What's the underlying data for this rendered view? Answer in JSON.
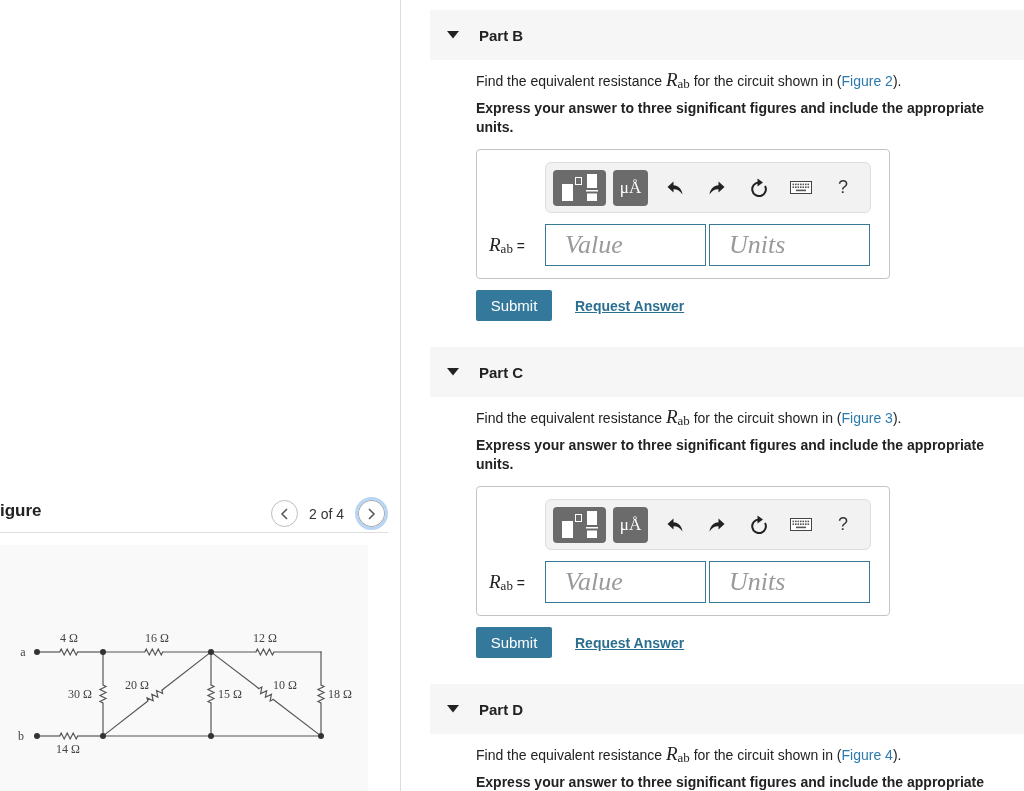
{
  "figure_panel": {
    "title": "igure",
    "nav": {
      "previous": {
        "focused": false
      },
      "counter": "2 of 4",
      "next": {
        "focused": true
      }
    },
    "circuit": {
      "terminals": [
        "a",
        "b"
      ],
      "resistors": [
        "4 Ω",
        "16 Ω",
        "12 Ω",
        "30 Ω",
        "20 Ω",
        "15 Ω",
        "10 Ω",
        "18 Ω",
        "14 Ω"
      ]
    }
  },
  "parts": [
    {
      "title": "Part B",
      "expanded": true,
      "prompt_before": "Find the equivalent resistance *R*$_{ab}$ for the circuit shown in (",
      "figure_link": "Figure 2",
      "prompt_after": ").",
      "instruction": "Express your answer to three significant figures and include the appropriate units.",
      "answer": {
        "label": "*R*$_{ab}$ =",
        "toolbar": [
          {
            "kind": "templates"
          },
          {
            "kind": "units",
            "label": "μÅ"
          },
          {
            "kind": "undo"
          },
          {
            "kind": "redo"
          },
          {
            "kind": "reset"
          },
          {
            "kind": "keyboard"
          },
          {
            "kind": "help",
            "label": "?"
          }
        ],
        "value_placeholder": "Value",
        "units_placeholder": "Units"
      },
      "actions": {
        "submit": "Submit",
        "request": "Request Answer"
      }
    },
    {
      "title": "Part C",
      "expanded": true,
      "prompt_before": "Find the equivalent resistance *R*$_{ab}$ for the circuit shown in (",
      "figure_link": "Figure 3",
      "prompt_after": ").",
      "instruction": "Express your answer to three significant figures and include the appropriate units.",
      "answer": {
        "label": "*R*$_{ab}$ =",
        "toolbar": [
          {
            "kind": "templates"
          },
          {
            "kind": "units",
            "label": "μÅ"
          },
          {
            "kind": "undo"
          },
          {
            "kind": "redo"
          },
          {
            "kind": "reset"
          },
          {
            "kind": "keyboard"
          },
          {
            "kind": "help",
            "label": "?"
          }
        ],
        "value_placeholder": "Value",
        "units_placeholder": "Units"
      },
      "actions": {
        "submit": "Submit",
        "request": "Request Answer"
      }
    },
    {
      "title": "Part D",
      "expanded": true,
      "prompt_before": "Find the equivalent resistance *R*$_{ab}$ for the circuit shown in (",
      "figure_link": "Figure 4",
      "prompt_after": ").",
      "instruction": "Express your answer to three significant figures and include the appropriate"
    }
  ]
}
